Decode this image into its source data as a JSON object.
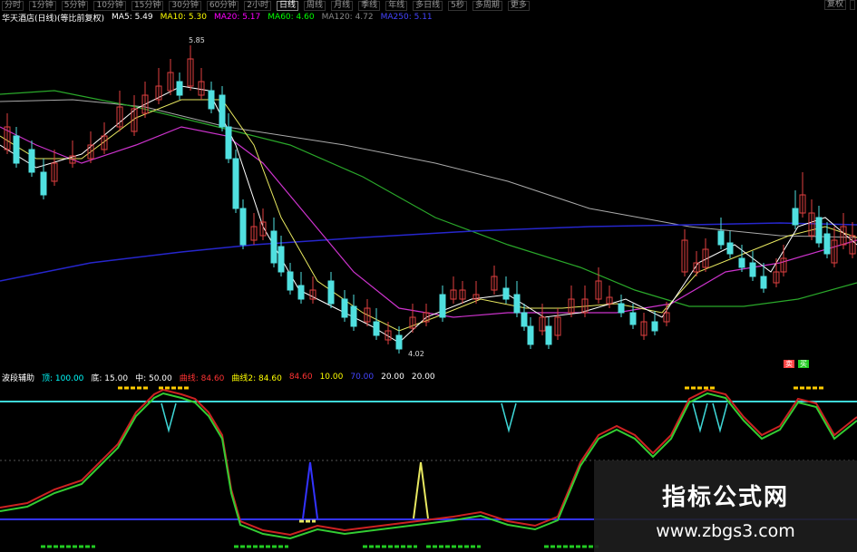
{
  "toolbar": {
    "tabs": [
      "分时",
      "1分钟",
      "5分钟",
      "10分钟",
      "15分钟",
      "30分钟",
      "60分钟",
      "2小时",
      "日线",
      "周线",
      "月线",
      "季线",
      "年线",
      "多日线",
      "5秒",
      "多周期",
      "更多"
    ],
    "right_buttons": [
      "复权",
      ""
    ]
  },
  "main_indicator": {
    "name": "华天酒店(日线)(等比前复权)",
    "items": [
      {
        "label": "MA5: 5.49",
        "color": "#ffffff"
      },
      {
        "label": "MA10: 5.30",
        "color": "#ffff00"
      },
      {
        "label": "MA20: 5.17",
        "color": "#ff00ff"
      },
      {
        "label": "MA60: 4.60",
        "color": "#00ff00"
      },
      {
        "label": "MA120: 4.72",
        "color": "#888888"
      },
      {
        "label": "MA250: 5.11",
        "color": "#4444ff"
      }
    ]
  },
  "price_labels": {
    "high": "5.85",
    "low": "4.02"
  },
  "sub_indicator": {
    "name": "波段辅助",
    "items": [
      {
        "label": "顶: 100.00",
        "color": "#00ffff"
      },
      {
        "label": "底: 15.00",
        "color": "#ffffff"
      },
      {
        "label": "中: 50.00",
        "color": "#ffffff"
      },
      {
        "label": "曲线: 84.60",
        "color": "#ff3333"
      },
      {
        "label": "曲线2: 84.60",
        "color": "#ffff00"
      },
      {
        "label": "84.60",
        "color": "#ff3333"
      },
      {
        "label": "10.00",
        "color": "#ffff00"
      },
      {
        "label": "70.00",
        "color": "#4444ff"
      },
      {
        "label": "20.00",
        "color": "#ffffff"
      },
      {
        "label": "20.00",
        "color": "#ffffff"
      }
    ]
  },
  "legend_boxes": [
    "卖",
    "买"
  ],
  "watermark": {
    "title": "指标公式网",
    "url": "www.zbgs3.com"
  }
}
